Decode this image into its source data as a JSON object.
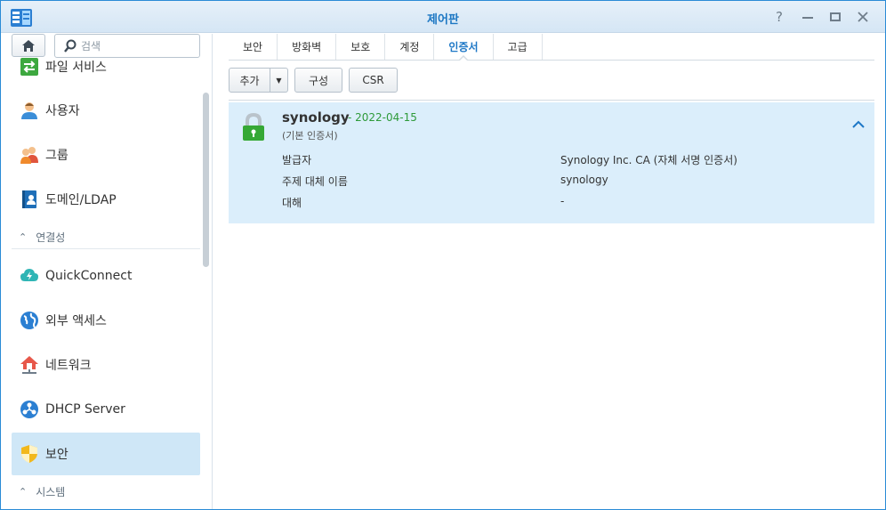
{
  "window": {
    "title": "제어판"
  },
  "sidebar": {
    "search_placeholder": "검색",
    "items": [
      {
        "label": "파일 서비스",
        "icon": "file-services-icon"
      },
      {
        "label": "사용자",
        "icon": "user-icon"
      },
      {
        "label": "그룹",
        "icon": "group-icon"
      },
      {
        "label": "도메인/LDAP",
        "icon": "domain-ldap-icon"
      },
      {
        "label": "QuickConnect",
        "icon": "quickconnect-icon"
      },
      {
        "label": "외부 액세스",
        "icon": "external-access-icon"
      },
      {
        "label": "네트워크",
        "icon": "network-icon"
      },
      {
        "label": "DHCP Server",
        "icon": "dhcp-server-icon"
      },
      {
        "label": "보안",
        "icon": "security-shield-icon"
      }
    ],
    "sections": [
      {
        "label": "연결성"
      },
      {
        "label": "시스템"
      }
    ],
    "active_item": "보안"
  },
  "tabs": [
    {
      "label": "보안"
    },
    {
      "label": "방화벽"
    },
    {
      "label": "보호"
    },
    {
      "label": "계정"
    },
    {
      "label": "인증서"
    },
    {
      "label": "고급"
    }
  ],
  "active_tab": "인증서",
  "toolbar": {
    "add_label": "추가",
    "config_label": "구성",
    "csr_label": "CSR"
  },
  "certificate": {
    "name": "synology",
    "date": "- 2022-04-15",
    "subtitle": "(기본 인증서)",
    "issuer_label": "발급자",
    "issuer_value": "Synology Inc. CA (자체 서명 인증서)",
    "san_label": "주제 대체 이름",
    "san_value": "synology",
    "for_label": "대해",
    "for_value": "-"
  },
  "colors": {
    "accent": "#1d77c6",
    "selected_bg": "#cfe7f7",
    "cert_bg": "#dbeefb",
    "date_green": "#2e9a3a"
  }
}
